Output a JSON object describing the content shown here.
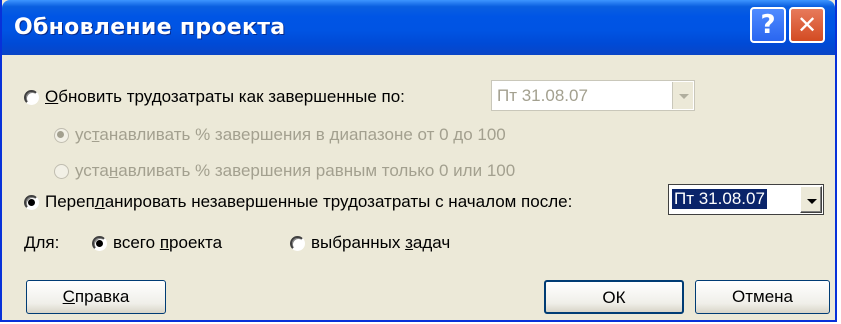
{
  "dialog": {
    "title": "Обновление проекта",
    "help_glyph": "?",
    "close_glyph": "✕"
  },
  "options": {
    "update_work": {
      "pre": "",
      "key": "О",
      "post": "бновить трудозатраты как завершенные по:",
      "checked": false
    },
    "update_date": {
      "value": "Пт 31.08.07",
      "enabled": false
    },
    "sub_range": {
      "pre": "ус",
      "key": "т",
      "post": "анавливать % завершения в диапазоне от 0 до 100",
      "checked": true,
      "enabled": false
    },
    "sub_binary": {
      "pre": "уста",
      "key": "н",
      "post": "авливать % завершения равным только 0 или 100",
      "checked": false,
      "enabled": false
    },
    "reschedule": {
      "pre": "Переп",
      "key": "л",
      "post": "анировать незавершенные трудозатраты с началом после:",
      "checked": true
    },
    "reschedule_date": {
      "value": "Пт 31.08.07",
      "enabled": true
    }
  },
  "scope": {
    "label": "Для:",
    "whole": {
      "pre": "всего ",
      "key": "п",
      "post": "роекта",
      "checked": true
    },
    "selected": {
      "pre": "выбранных ",
      "key": "з",
      "post": "адач",
      "checked": false
    }
  },
  "buttons": {
    "help": {
      "pre": "",
      "key": "С",
      "post": "правка"
    },
    "ok": "ОК",
    "cancel": "Отмена"
  }
}
